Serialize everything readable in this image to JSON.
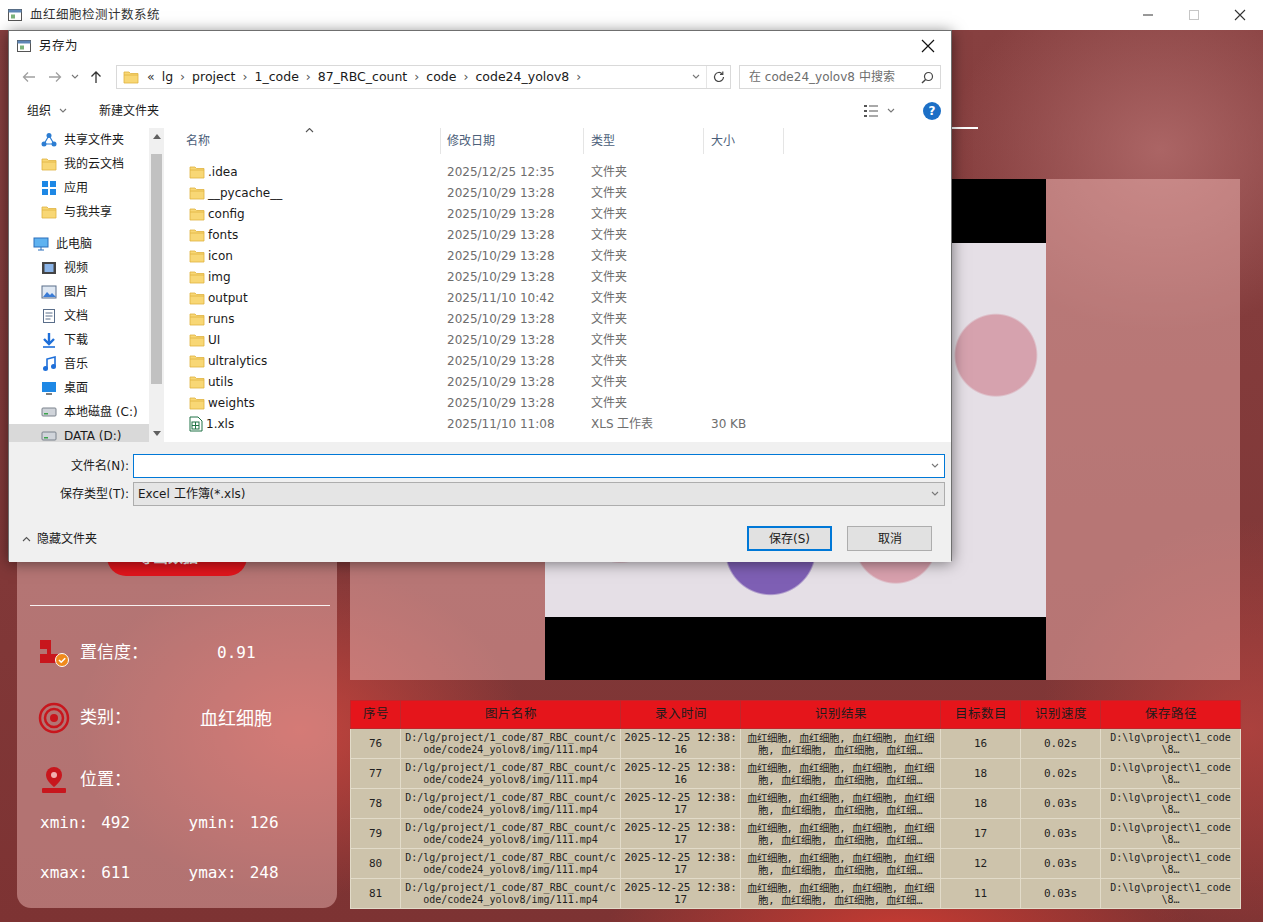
{
  "window": {
    "title": "血红细胞检测计数系统"
  },
  "panel": {
    "export_button": "导出数据 >",
    "confidence": {
      "label": "置信度：",
      "value": "0.91"
    },
    "category": {
      "label": "类别：",
      "value": "血红细胞"
    },
    "position": {
      "label": "位置：",
      "coords": [
        {
          "label": "xmin:",
          "value": "492"
        },
        {
          "label": "ymin:",
          "value": "126"
        },
        {
          "label": "xmax:",
          "value": "611"
        },
        {
          "label": "ymax:",
          "value": "248"
        }
      ]
    }
  },
  "table": {
    "columns": [
      "序号",
      "图片名称",
      "录入时间",
      "识别结果",
      "目标数目",
      "识别速度",
      "保存路径"
    ],
    "rows": [
      [
        "76",
        "D:/lg/project/1_code/87_RBC_count/code/code24_yolov8/img/111.mp4",
        "2025-12-25 12:38:16",
        "血红细胞, 血红细胞, 血红细胞, 血红细胞, 血红细胞, 血红细胞, 血红细…",
        "16",
        "0.02s",
        "D:\\lg\\project\\1_code\\8…"
      ],
      [
        "77",
        "D:/lg/project/1_code/87_RBC_count/code/code24_yolov8/img/111.mp4",
        "2025-12-25 12:38:16",
        "血红细胞, 血红细胞, 血红细胞, 血红细胞, 血红细胞, 血红细胞, 血红细…",
        "18",
        "0.02s",
        "D:\\lg\\project\\1_code\\8…"
      ],
      [
        "78",
        "D:/lg/project/1_code/87_RBC_count/code/code24_yolov8/img/111.mp4",
        "2025-12-25 12:38:17",
        "血红细胞, 血红细胞, 血红细胞, 血红细胞, 血红细胞, 血红细胞, 血红细…",
        "18",
        "0.03s",
        "D:\\lg\\project\\1_code\\8…"
      ],
      [
        "79",
        "D:/lg/project/1_code/87_RBC_count/code/code24_yolov8/img/111.mp4",
        "2025-12-25 12:38:17",
        "血红细胞, 血红细胞, 血红细胞, 血红细胞, 血红细胞, 血红细胞, 血红细…",
        "17",
        "0.03s",
        "D:\\lg\\project\\1_code\\8…"
      ],
      [
        "80",
        "D:/lg/project/1_code/87_RBC_count/code/code24_yolov8/img/111.mp4",
        "2025-12-25 12:38:17",
        "血红细胞, 血红细胞, 血红细胞, 血红细胞, 血红细胞, 血红细胞, 血红细…",
        "12",
        "0.03s",
        "D:\\lg\\project\\1_code\\8…"
      ],
      [
        "81",
        "D:/lg/project/1_code/87_RBC_count/code/code24_yolov8/img/111.mp4",
        "2025-12-25 12:38:17",
        "血红细胞, 血红细胞, 血红细胞, 血红细胞, 血红细胞, 血红细胞, 血红细…",
        "11",
        "0.03s",
        "D:\\lg\\project\\1_code\\8…"
      ]
    ]
  },
  "dialog": {
    "title": "另存为",
    "address": {
      "overflow": "«",
      "separator": "›",
      "crumbs": [
        "lg",
        "project",
        "1_code",
        "87_RBC_count",
        "code",
        "code24_yolov8"
      ]
    },
    "search": {
      "placeholder": "在 code24_yolov8 中搜索"
    },
    "toolbar": {
      "organize": "组织",
      "new_folder": "新建文件夹",
      "help": "?"
    },
    "nav": [
      {
        "label": "共享文件夹",
        "kind": "share",
        "selected": false
      },
      {
        "label": "我的云文档",
        "kind": "folder",
        "selected": false
      },
      {
        "label": "应用",
        "kind": "apps",
        "selected": false
      },
      {
        "label": "与我共享",
        "kind": "folder",
        "selected": false
      },
      {
        "label": "此电脑",
        "kind": "pc",
        "selected": false
      },
      {
        "label": "视频",
        "kind": "video",
        "selected": false
      },
      {
        "label": "图片",
        "kind": "pictures",
        "selected": false
      },
      {
        "label": "文档",
        "kind": "documents",
        "selected": false
      },
      {
        "label": "下载",
        "kind": "downloads",
        "selected": false
      },
      {
        "label": "音乐",
        "kind": "music",
        "selected": false
      },
      {
        "label": "桌面",
        "kind": "desktop",
        "selected": false
      },
      {
        "label": "本地磁盘 (C:)",
        "kind": "drive",
        "selected": false
      },
      {
        "label": "DATA (D:)",
        "kind": "drive",
        "selected": true
      }
    ],
    "nav_scrollbar": {
      "level": 0.85
    },
    "columns": [
      "名称",
      "修改日期",
      "类型",
      "大小"
    ],
    "files": [
      {
        "name": ".idea",
        "modified": "2025/12/25 12:35",
        "type": "文件夹",
        "size": "",
        "kind": "folder"
      },
      {
        "name": "__pycache__",
        "modified": "2025/10/29 13:28",
        "type": "文件夹",
        "size": "",
        "kind": "folder"
      },
      {
        "name": "config",
        "modified": "2025/10/29 13:28",
        "type": "文件夹",
        "size": "",
        "kind": "folder"
      },
      {
        "name": "fonts",
        "modified": "2025/10/29 13:28",
        "type": "文件夹",
        "size": "",
        "kind": "folder"
      },
      {
        "name": "icon",
        "modified": "2025/10/29 13:28",
        "type": "文件夹",
        "size": "",
        "kind": "folder"
      },
      {
        "name": "img",
        "modified": "2025/10/29 13:28",
        "type": "文件夹",
        "size": "",
        "kind": "folder"
      },
      {
        "name": "output",
        "modified": "2025/11/10 10:42",
        "type": "文件夹",
        "size": "",
        "kind": "folder"
      },
      {
        "name": "runs",
        "modified": "2025/10/29 13:28",
        "type": "文件夹",
        "size": "",
        "kind": "folder"
      },
      {
        "name": "UI",
        "modified": "2025/10/29 13:28",
        "type": "文件夹",
        "size": "",
        "kind": "folder"
      },
      {
        "name": "ultralytics",
        "modified": "2025/10/29 13:28",
        "type": "文件夹",
        "size": "",
        "kind": "folder"
      },
      {
        "name": "utils",
        "modified": "2025/10/29 13:28",
        "type": "文件夹",
        "size": "",
        "kind": "folder"
      },
      {
        "name": "weights",
        "modified": "2025/10/29 13:28",
        "type": "文件夹",
        "size": "",
        "kind": "folder"
      },
      {
        "name": "1.xls",
        "modified": "2025/11/10 11:08",
        "type": "XLS 工作表",
        "size": "30 KB",
        "kind": "spreadsheet"
      }
    ],
    "filename": {
      "label": "文件名(N):",
      "value": "",
      "focused": true
    },
    "filetype": {
      "label": "保存类型(T):",
      "value": "Excel 工作簿(*.xls)"
    },
    "hide_folders": "隐藏文件夹",
    "buttons": [
      {
        "label": "保存(S)",
        "default": true
      },
      {
        "label": "取消",
        "default": false
      }
    ]
  }
}
